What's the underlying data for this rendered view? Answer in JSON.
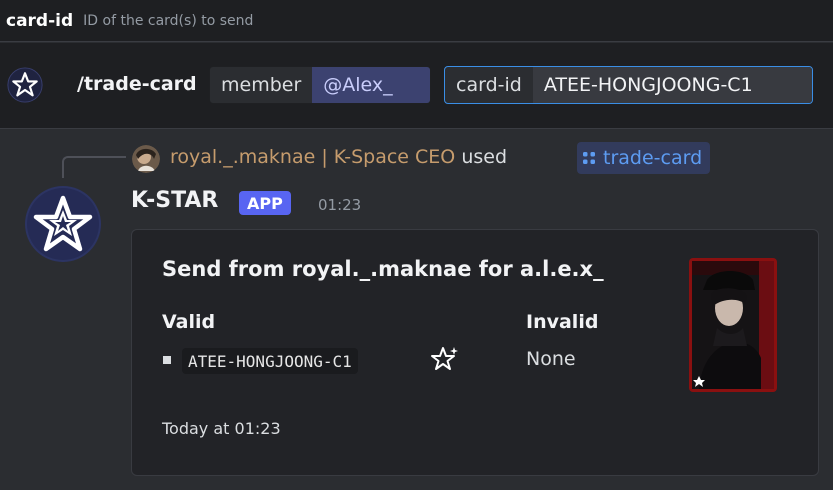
{
  "hint": {
    "option": "card-id",
    "description": "ID of the card(s) to send"
  },
  "command_bar": {
    "command": "/trade-card",
    "member": {
      "label": "member",
      "value": "@Alex_"
    },
    "card_id": {
      "label": "card-id",
      "value": "ATEE-HONGJOONG-C1"
    },
    "app_icon": "star-logo-icon"
  },
  "reply": {
    "user": "royal._.maknae | K-Space CEO",
    "used_text": "used",
    "command_chip": "trade-card",
    "chip_icon": "command-dots-icon"
  },
  "message": {
    "author": "K-STAR",
    "badge": "APP",
    "time": "01:23"
  },
  "embed": {
    "title": "Send from royal._.maknae for a.l.e.x_",
    "fields": [
      {
        "name": "Valid",
        "value": "ATEE-HONGJOONG-C1",
        "icon": "sparkle-star-icon"
      },
      {
        "name": "Invalid",
        "value": "None"
      }
    ],
    "footer": "Today at 01:23",
    "thumbnail": "card-photo"
  },
  "colors": {
    "background": "#2b2d31",
    "bar": "#1e1f22",
    "accent_blue": "#3a8ee6",
    "badge": "#5865f2",
    "reply_user": "#c69c6d",
    "chip_text": "#5d9cf2"
  }
}
